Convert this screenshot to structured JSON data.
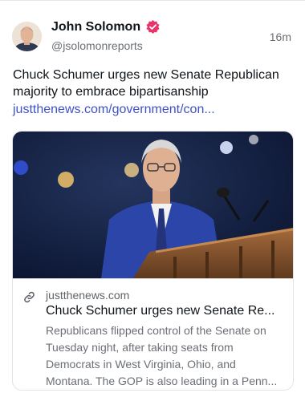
{
  "post": {
    "author_name": "John Solomon",
    "handle": "@jsolomonreports",
    "time": "16m",
    "text": "Chuck Schumer urges new Senate Republican majority to embrace bipartisanship",
    "link": "justthenews.com/government/con..."
  },
  "card": {
    "domain": "justthenews.com",
    "title": "Chuck Schumer urges new Senate Re...",
    "description": "Republicans flipped control of the Senate on Tuesday night, after taking seats from Democrats in West Virginia, Ohio, and Montana. The GOP is also leading in a Penn..."
  },
  "colors": {
    "verified_badge": "#e8336b",
    "link": "#3f51c7",
    "stage_background": "#0e1a3a",
    "podium": "#8a5630"
  },
  "icons": {
    "verified": "verified-badge-icon",
    "link": "link-icon"
  }
}
